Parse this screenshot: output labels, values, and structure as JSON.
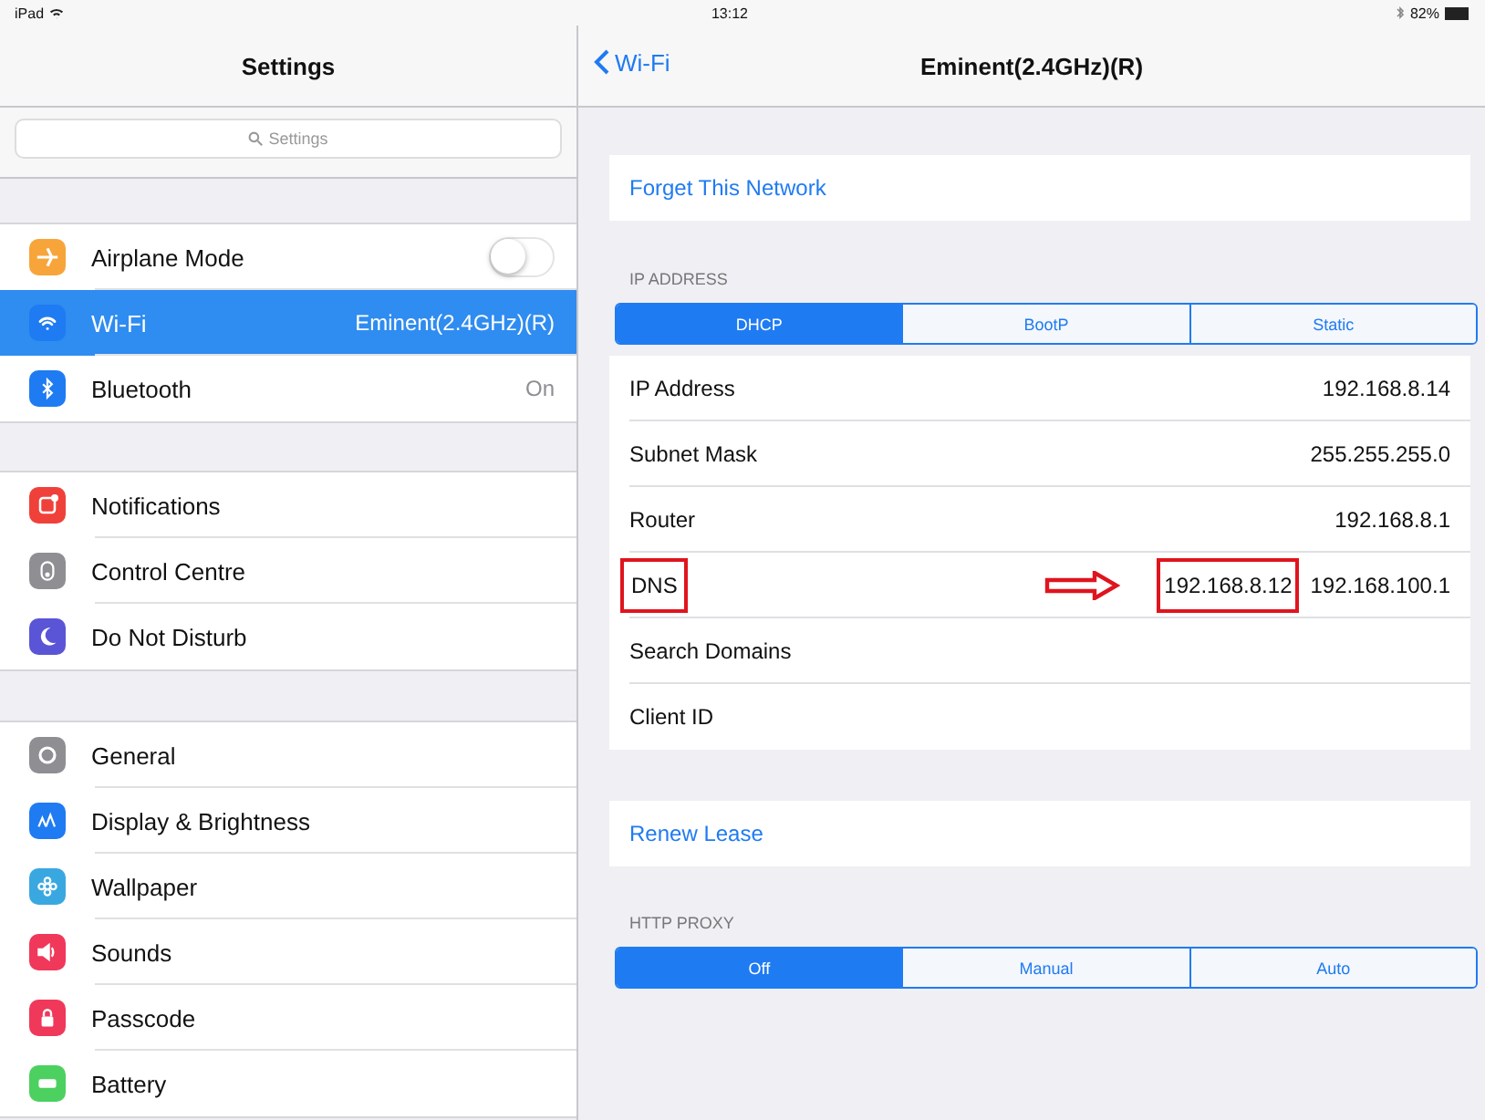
{
  "status_bar": {
    "device": "iPad",
    "time": "13:12",
    "battery": "82%"
  },
  "sidebar": {
    "title": "Settings",
    "search_placeholder": "Settings",
    "groups": [
      [
        {
          "label": "Airplane Mode",
          "kind": "toggle",
          "on": false,
          "selected": false,
          "color": "#f7a53a"
        },
        {
          "label": "Wi-Fi",
          "kind": "value",
          "value": "Eminent(2.4GHz)(R)",
          "selected": true,
          "color": "#1f7bf2"
        },
        {
          "label": "Bluetooth",
          "kind": "value",
          "value": "On",
          "selected": false,
          "color": "#1f7bf2"
        }
      ],
      [
        {
          "label": "Notifications",
          "kind": "plain",
          "selected": false,
          "color": "#f0403a"
        },
        {
          "label": "Control Centre",
          "kind": "plain",
          "selected": false,
          "color": "#8e8e93"
        },
        {
          "label": "Do Not Disturb",
          "kind": "plain",
          "selected": false,
          "color": "#5a55d6"
        }
      ],
      [
        {
          "label": "General",
          "kind": "plain",
          "selected": false,
          "color": "#8e8e93"
        },
        {
          "label": "Display & Brightness",
          "kind": "plain",
          "selected": false,
          "color": "#1f7bf2"
        },
        {
          "label": "Wallpaper",
          "kind": "plain",
          "selected": false,
          "color": "#3aa8e0"
        },
        {
          "label": "Sounds",
          "kind": "plain",
          "selected": false,
          "color": "#f0385a"
        },
        {
          "label": "Passcode",
          "kind": "plain",
          "selected": false,
          "color": "#f0385a"
        },
        {
          "label": "Battery",
          "kind": "plain",
          "selected": false,
          "color": "#4cd060"
        }
      ]
    ]
  },
  "detail": {
    "back": "Wi-Fi",
    "title": "Eminent(2.4GHz)(R)",
    "forget": "Forget This Network",
    "ip_header": "IP ADDRESS",
    "ip_modes": [
      {
        "label": "DHCP",
        "selected": true
      },
      {
        "label": "BootP",
        "selected": false
      },
      {
        "label": "Static",
        "selected": false
      }
    ],
    "rows": [
      {
        "label": "IP Address",
        "label_highlighted": false,
        "arrow": false,
        "values": [
          {
            "text": "192.168.8.14",
            "highlighted": false
          }
        ]
      },
      {
        "label": "Subnet Mask",
        "label_highlighted": false,
        "arrow": false,
        "values": [
          {
            "text": "255.255.255.0",
            "highlighted": false
          }
        ]
      },
      {
        "label": "Router",
        "label_highlighted": false,
        "arrow": false,
        "values": [
          {
            "text": "192.168.8.1",
            "highlighted": false
          }
        ]
      },
      {
        "label": "DNS",
        "label_highlighted": true,
        "arrow": true,
        "values": [
          {
            "text": "192.168.8.12",
            "highlighted": true
          },
          {
            "text": "192.168.100.1",
            "highlighted": false
          }
        ]
      },
      {
        "label": "Search Domains",
        "label_highlighted": false,
        "arrow": false,
        "values": []
      },
      {
        "label": "Client ID",
        "label_highlighted": false,
        "arrow": false,
        "values": []
      }
    ],
    "renew": "Renew Lease",
    "proxy_header": "HTTP PROXY",
    "proxy_modes": [
      {
        "label": "Off",
        "selected": true
      },
      {
        "label": "Manual",
        "selected": false
      },
      {
        "label": "Auto",
        "selected": false
      }
    ]
  }
}
